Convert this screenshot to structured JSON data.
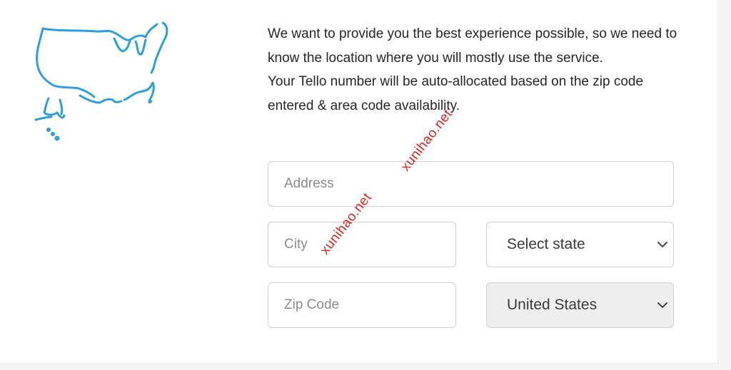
{
  "intro": {
    "line1": "We want to provide you the best experience possible, so we need to know the location where you will mostly use the service.",
    "line2": "Your Tello number will be auto-allocated based on the zip code entered & area code availability."
  },
  "form": {
    "address_placeholder": "Address",
    "city_placeholder": "City",
    "state_selected": "Select state",
    "zip_placeholder": "Zip Code",
    "country_selected": "United States"
  },
  "watermark": {
    "text1": "xunihao.net",
    "text2": "xunihao.net"
  },
  "icons": {
    "map": "usa-map-outline-icon",
    "chevron": "chevron-down-icon"
  },
  "colors": {
    "map_stroke": "#2a9ee0",
    "watermark": "#e2231a",
    "disabled_field": "#eeeeee"
  }
}
